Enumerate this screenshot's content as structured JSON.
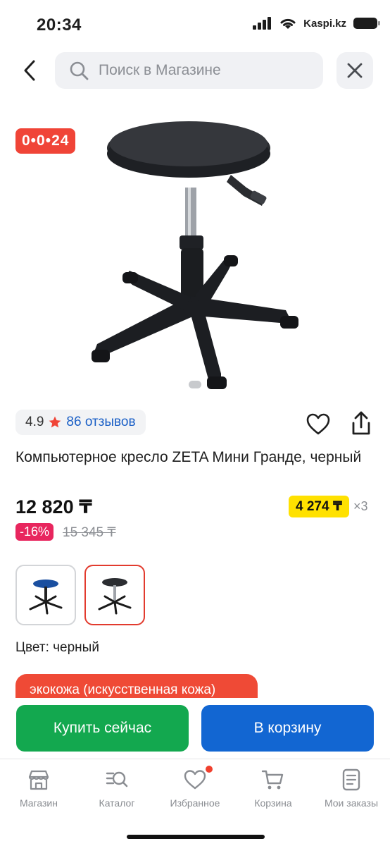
{
  "status_bar": {
    "time": "20:34",
    "carrier": "Kaspi.kz",
    "icons": [
      "signal-icon",
      "wifi-icon",
      "battery-icon"
    ]
  },
  "search": {
    "placeholder": "Поиск в Магазине",
    "icons": [
      "back-arrow-icon",
      "search-icon",
      "close-icon"
    ]
  },
  "gallery": {
    "promo_badge": "0•0•24",
    "image_count": 1,
    "current_image": 1
  },
  "rating": {
    "value": "4.9",
    "reviews": "86 отзывов",
    "star_color": "#f04437"
  },
  "product": {
    "title": "Компьютерное кресло ZETA Мини Гранде, черный",
    "price": "12 820 ₸",
    "installment_amount": "4 274 ₸",
    "installment_times": "×3",
    "discount": "-16%",
    "old_price": "15 345 ₸"
  },
  "variants": [
    {
      "name": "синий",
      "color": "#1a4fa0",
      "selected": false
    },
    {
      "name": "черный",
      "color": "#222222",
      "selected": true
    }
  ],
  "color_label": "Цвет: черный",
  "material_chip": "экокожа (искусственная кожа)",
  "actions": {
    "buy_now": "Купить сейчас",
    "add_to_cart": "В корзину"
  },
  "bottom_nav": [
    {
      "label": "Магазин",
      "icon": "shop-icon"
    },
    {
      "label": "Каталог",
      "icon": "catalog-icon"
    },
    {
      "label": "Избранное",
      "icon": "heart-icon",
      "badge": true
    },
    {
      "label": "Корзина",
      "icon": "cart-icon"
    },
    {
      "label": "Мои заказы",
      "icon": "orders-icon"
    }
  ],
  "colors": {
    "accent_red": "#f04437",
    "buy_green": "#13a84f",
    "cart_blue": "#1266d2",
    "installment_yellow": "#ffe100",
    "discount_pink": "#e8265e",
    "link_blue": "#1a5fc6"
  }
}
